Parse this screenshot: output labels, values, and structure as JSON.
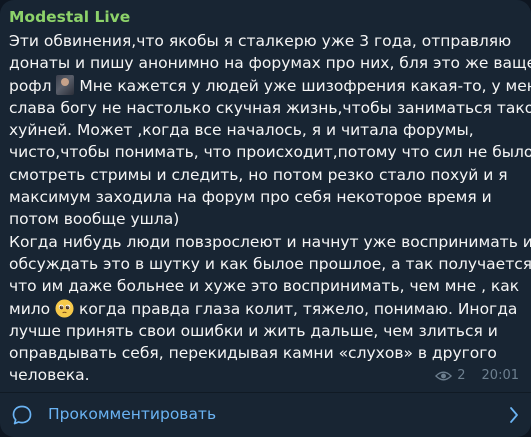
{
  "post": {
    "author": "Modestal Live",
    "lines": [
      "Эти обвинения,что якобы я сталкерю уже 3 года, отправляю",
      "донаты и пишу анонимно на форумах про них, бля это же ваще",
      "рофл",
      " Мне кажется у людей уже шизофрения какая-то, у меня",
      "слава богу не настолько скучная жизнь,чтобы заниматься такой",
      "хуйней. Может ,когда все началось, я и читала форумы,",
      "чисто,чтобы понимать, что происходит,потому что сил не было",
      "смотреть стримы и следить, но потом резко стало похуй и я",
      "максимум заходила на форум про себя некоторое время и",
      "потом вообще ушла)",
      "Когда нибудь люди повзрослеют и начнут уже воспринимать и",
      "обсуждать это в шутку и как былое прошлое, а так получается,",
      "что им даже больнее и хуже это воспринимать, чем мне , как",
      "мило ",
      " когда правда глаза колит, тяжело, понимаю. Иногда",
      "лучше принять свои ошибки и жить дальше, чем злиться и",
      "оправдывать себя, перекидывая камни «слухов» в другого",
      "человека."
    ],
    "views": "2",
    "time": "20:01"
  },
  "footer": {
    "comment_label": "Прокомментировать"
  },
  "colors": {
    "background": "#182533",
    "author": "#8dd26a",
    "text": "#f5f5f5",
    "meta": "#6d7f8f",
    "link": "#6ab3f3"
  },
  "icons": {
    "inline_image": "photo-thumbnail",
    "inline_emoji": "pleading-face-emoji",
    "views": "eye-icon",
    "comments": "comment-bubble-icon",
    "chevron": "chevron-right-icon"
  }
}
